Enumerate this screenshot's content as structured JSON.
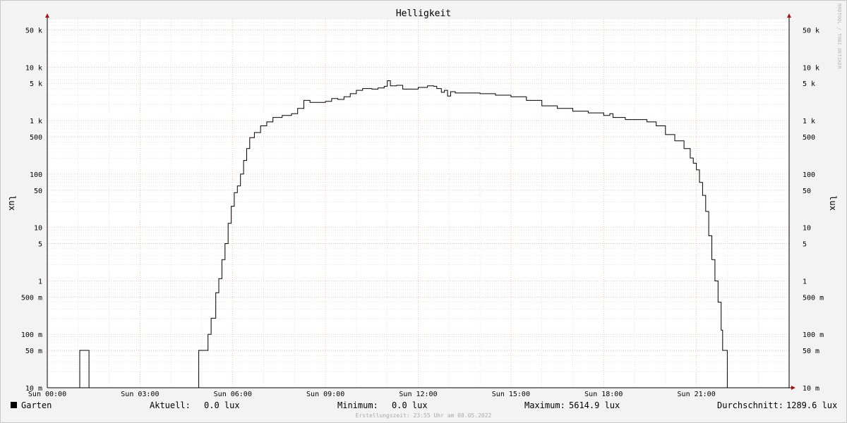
{
  "chart_data": {
    "type": "line",
    "title": "Helligkeit",
    "ylabel": "lux",
    "ylabel_right": "lux",
    "y_scale": "log",
    "ylim": [
      0.01,
      80000
    ],
    "xlim": [
      0,
      24
    ],
    "grid": true,
    "y_ticks": [
      {
        "v": 0.01,
        "label": "10 m"
      },
      {
        "v": 0.05,
        "label": "50 m"
      },
      {
        "v": 0.1,
        "label": "100 m"
      },
      {
        "v": 0.5,
        "label": "500 m"
      },
      {
        "v": 1,
        "label": "1"
      },
      {
        "v": 5,
        "label": "5"
      },
      {
        "v": 10,
        "label": "10"
      },
      {
        "v": 50,
        "label": "50"
      },
      {
        "v": 100,
        "label": "100"
      },
      {
        "v": 500,
        "label": "500"
      },
      {
        "v": 1000,
        "label": "1 k"
      },
      {
        "v": 5000,
        "label": "5 k"
      },
      {
        "v": 10000,
        "label": "10 k"
      },
      {
        "v": 50000,
        "label": "50 k"
      }
    ],
    "x_ticks": [
      {
        "v": 0,
        "label": "Sun 00:00"
      },
      {
        "v": 3,
        "label": "Sun 03:00"
      },
      {
        "v": 6,
        "label": "Sun 06:00"
      },
      {
        "v": 9,
        "label": "Sun 09:00"
      },
      {
        "v": 12,
        "label": "Sun 12:00"
      },
      {
        "v": 15,
        "label": "Sun 15:00"
      },
      {
        "v": 18,
        "label": "Sun 18:00"
      },
      {
        "v": 21,
        "label": "Sun 21:00"
      }
    ],
    "series": [
      {
        "name": "Garten",
        "color": "#000000",
        "points": [
          [
            0,
            0.01
          ],
          [
            1.05,
            0.01
          ],
          [
            1.05,
            0.05
          ],
          [
            1.35,
            0.05
          ],
          [
            1.35,
            0.01
          ],
          [
            4.9,
            0.01
          ],
          [
            4.9,
            0.05
          ],
          [
            5.1,
            0.05
          ],
          [
            5.2,
            0.1
          ],
          [
            5.3,
            0.2
          ],
          [
            5.45,
            0.6
          ],
          [
            5.55,
            1.1
          ],
          [
            5.65,
            2.5
          ],
          [
            5.75,
            5
          ],
          [
            5.85,
            12
          ],
          [
            5.95,
            25
          ],
          [
            6.05,
            45
          ],
          [
            6.15,
            60
          ],
          [
            6.25,
            100
          ],
          [
            6.35,
            180
          ],
          [
            6.45,
            300
          ],
          [
            6.55,
            480
          ],
          [
            6.7,
            600
          ],
          [
            6.9,
            800
          ],
          [
            7.1,
            950
          ],
          [
            7.3,
            1150
          ],
          [
            7.6,
            1250
          ],
          [
            7.9,
            1350
          ],
          [
            8.1,
            1700
          ],
          [
            8.3,
            2400
          ],
          [
            8.5,
            2200
          ],
          [
            8.8,
            2200
          ],
          [
            9.0,
            2300
          ],
          [
            9.2,
            2600
          ],
          [
            9.4,
            2500
          ],
          [
            9.6,
            2800
          ],
          [
            9.8,
            3200
          ],
          [
            10.0,
            3700
          ],
          [
            10.2,
            4000
          ],
          [
            10.5,
            3900
          ],
          [
            10.7,
            4100
          ],
          [
            10.9,
            4400
          ],
          [
            11.0,
            5600
          ],
          [
            11.1,
            4500
          ],
          [
            11.3,
            4600
          ],
          [
            11.5,
            3900
          ],
          [
            11.8,
            3900
          ],
          [
            12.0,
            4200
          ],
          [
            12.3,
            4500
          ],
          [
            12.5,
            4400
          ],
          [
            12.6,
            4000
          ],
          [
            12.75,
            3400
          ],
          [
            12.85,
            3700
          ],
          [
            12.95,
            2900
          ],
          [
            13.05,
            3500
          ],
          [
            13.2,
            3300
          ],
          [
            13.5,
            3300
          ],
          [
            14.0,
            3200
          ],
          [
            14.5,
            3000
          ],
          [
            15.0,
            2800
          ],
          [
            15.5,
            2400
          ],
          [
            16.0,
            1900
          ],
          [
            16.5,
            1700
          ],
          [
            17.0,
            1500
          ],
          [
            17.5,
            1400
          ],
          [
            18.0,
            1250
          ],
          [
            18.2,
            1350
          ],
          [
            18.3,
            1150
          ],
          [
            18.5,
            1150
          ],
          [
            18.7,
            1050
          ],
          [
            19.0,
            1050
          ],
          [
            19.4,
            950
          ],
          [
            19.7,
            800
          ],
          [
            20.0,
            550
          ],
          [
            20.3,
            420
          ],
          [
            20.6,
            300
          ],
          [
            20.8,
            200
          ],
          [
            20.9,
            160
          ],
          [
            21.0,
            120
          ],
          [
            21.1,
            70
          ],
          [
            21.2,
            40
          ],
          [
            21.3,
            20
          ],
          [
            21.4,
            7
          ],
          [
            21.5,
            2.5
          ],
          [
            21.6,
            1
          ],
          [
            21.7,
            0.4
          ],
          [
            21.8,
            0.12
          ],
          [
            21.85,
            0.05
          ],
          [
            21.95,
            0.05
          ],
          [
            22.0,
            0.01
          ],
          [
            24,
            0.01
          ]
        ]
      }
    ]
  },
  "watermark": "RRDTOOL / TOBI OETIKER",
  "legend": {
    "series_name": "Garten",
    "color": "#000000",
    "stats": [
      {
        "label": "Aktuell:",
        "value": "0.0 lux"
      },
      {
        "label": "Minimum:",
        "value": "0.0 lux"
      },
      {
        "label": "Maximum:",
        "value": "5614.9 lux"
      },
      {
        "label": "Durchschnitt:",
        "value": "1289.6 lux"
      }
    ]
  },
  "footer": "Erstellungszeit: 23:55 Uhr am 08.05.2022"
}
